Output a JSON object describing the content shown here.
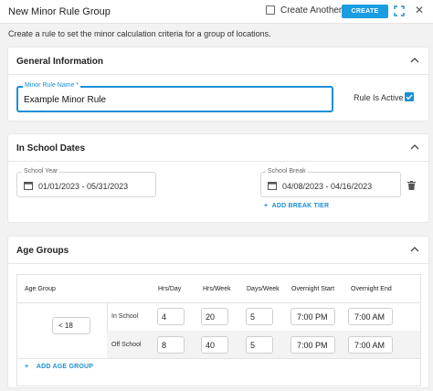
{
  "header": {
    "title": "New Minor Rule Group",
    "create_another_label": "Create Another",
    "create_label": "CREATE"
  },
  "description": "Create a rule to set the minor calculation criteria for a group of locations.",
  "general": {
    "title": "General Information",
    "rule_name_label": "Minor Rule Name *",
    "rule_name_value": "Example Minor Rule",
    "active_label": "Rule Is Active",
    "active_checked": true
  },
  "school_dates": {
    "title": "In School Dates",
    "school_year_label": "School Year",
    "school_year_value": "01/01/2023 - 05/31/2023",
    "school_break_label": "School Break",
    "school_break_value": "04/08/2023 - 04/16/2023",
    "add_break_label": "ADD BREAK TIER"
  },
  "age_groups": {
    "title": "Age Groups",
    "columns": [
      "Age Group",
      "Hrs/Day",
      "Hrs/Week",
      "Days/Week",
      "Overnight Start",
      "Overnight End"
    ],
    "age_value": "< 18",
    "rows": [
      {
        "label": "In School",
        "hrs_day": "4",
        "hrs_week": "20",
        "days_week": "5",
        "start": "7:00 PM",
        "end": "7:00 AM"
      },
      {
        "label": "Off School",
        "hrs_day": "8",
        "hrs_week": "40",
        "days_week": "5",
        "start": "7:00 PM",
        "end": "7:00 AM"
      }
    ],
    "add_label": "ADD AGE GROUP"
  },
  "colors": {
    "accent": "#1a9de1",
    "link": "#1a8fd6"
  }
}
